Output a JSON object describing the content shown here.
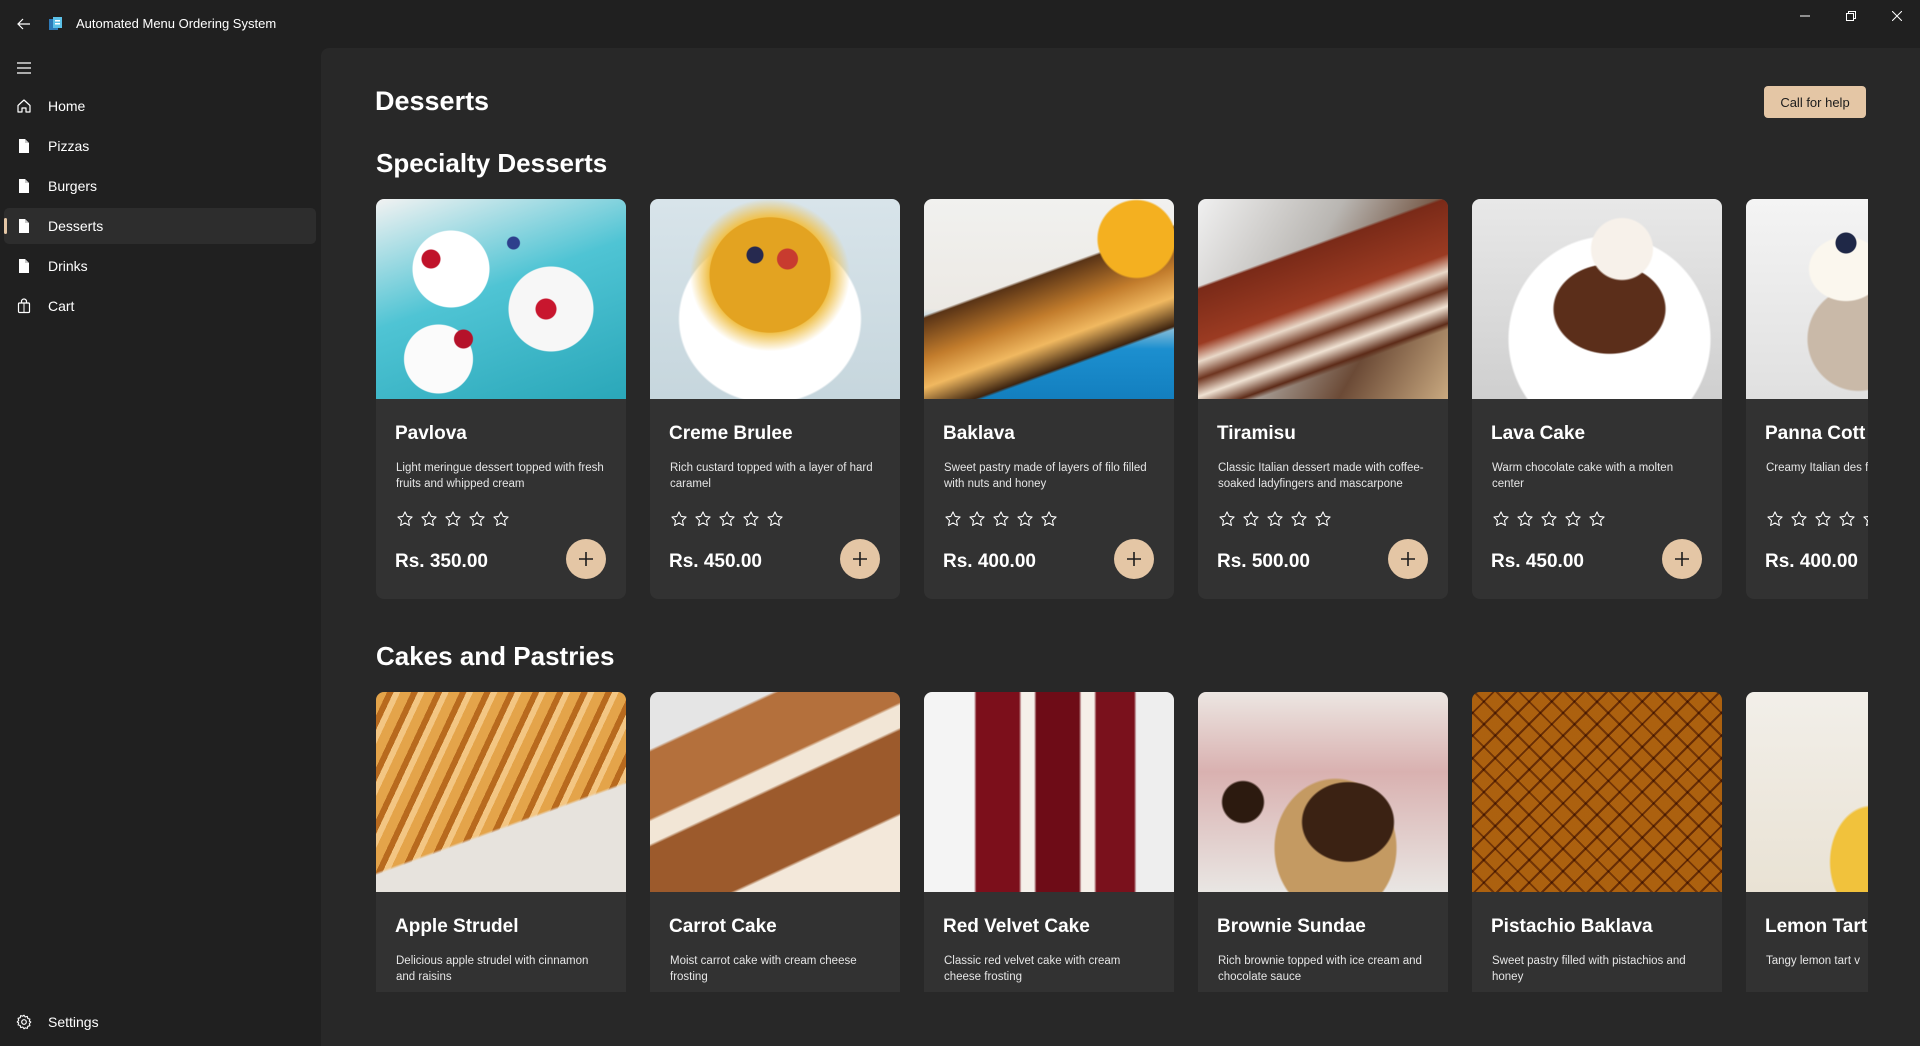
{
  "window": {
    "title": "Automated Menu Ordering System"
  },
  "sidebar": {
    "items": [
      {
        "label": "Home",
        "icon": "home-icon"
      },
      {
        "label": "Pizzas",
        "icon": "document-icon"
      },
      {
        "label": "Burgers",
        "icon": "document-icon"
      },
      {
        "label": "Desserts",
        "icon": "document-icon",
        "selected": true
      },
      {
        "label": "Drinks",
        "icon": "document-icon"
      },
      {
        "label": "Cart",
        "icon": "shopping-bag-icon"
      }
    ],
    "settings_label": "Settings"
  },
  "page": {
    "title": "Desserts",
    "help_button": "Call for help"
  },
  "sections": [
    {
      "title": "Specialty Desserts",
      "items": [
        {
          "name": "Pavlova",
          "description": "Light meringue dessert topped with fresh fruits and whipped cream",
          "price": "Rs. 350.00",
          "rating": 0
        },
        {
          "name": "Creme Brulee",
          "description": "Rich custard topped with a layer of hard caramel",
          "price": "Rs. 450.00",
          "rating": 0
        },
        {
          "name": "Baklava",
          "description": "Sweet pastry made of layers of filo filled with nuts and honey",
          "price": "Rs. 400.00",
          "rating": 0
        },
        {
          "name": "Tiramisu",
          "description": "Classic Italian dessert made with coffee-soaked ladyfingers and mascarpone",
          "price": "Rs. 500.00",
          "rating": 0
        },
        {
          "name": "Lava Cake",
          "description": "Warm chocolate cake with a molten center",
          "price": "Rs. 450.00",
          "rating": 0
        },
        {
          "name": "Panna Cott",
          "description": "Creamy Italian des fruit sauce",
          "price": "Rs. 400.00",
          "rating": 0
        }
      ]
    },
    {
      "title": "Cakes and Pastries",
      "items": [
        {
          "name": "Apple Strudel",
          "description": "Delicious apple strudel with cinnamon and raisins"
        },
        {
          "name": "Carrot Cake",
          "description": "Moist carrot cake with cream cheese frosting"
        },
        {
          "name": "Red Velvet Cake",
          "description": "Classic red velvet cake with cream cheese frosting"
        },
        {
          "name": "Brownie Sundae",
          "description": "Rich brownie topped with ice cream and chocolate sauce"
        },
        {
          "name": "Pistachio Baklava",
          "description": "Sweet pastry filled with pistachios and honey"
        },
        {
          "name": "Lemon Tart",
          "description": "Tangy lemon tart v"
        }
      ]
    }
  ],
  "colors": {
    "accent": "#e4c6a5",
    "background": "#202020",
    "content_bg": "#282828",
    "card_bg": "#323232"
  }
}
